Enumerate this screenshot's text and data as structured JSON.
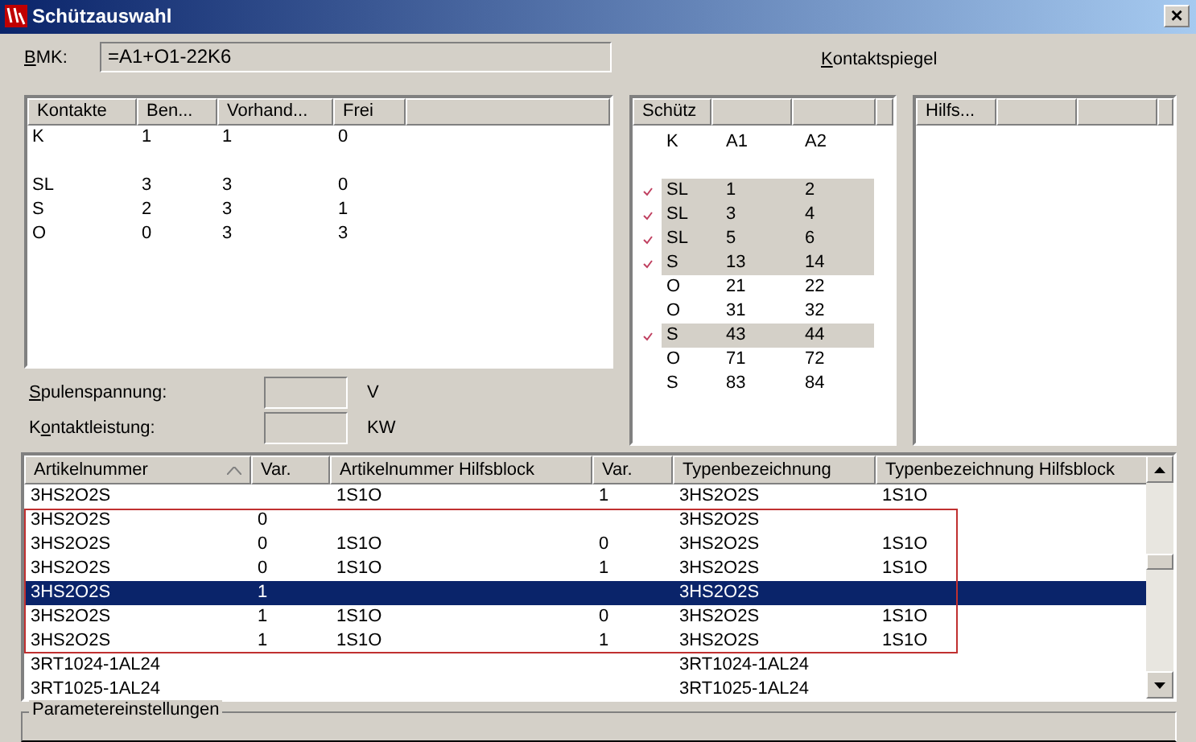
{
  "window": {
    "title": "Schützauswahl",
    "close": "×"
  },
  "bmk": {
    "label": "BMK:",
    "value": "=A1+O1-22K6"
  },
  "mirror_label": "Kontaktspiegel",
  "contacts": {
    "columns": [
      "Kontakte",
      "Ben...",
      "Vorhand...",
      "Frei"
    ],
    "rows": [
      {
        "kind": "row",
        "cells": [
          "K",
          "1",
          "1",
          "0"
        ]
      },
      {
        "kind": "gap"
      },
      {
        "kind": "row",
        "cells": [
          "SL",
          "3",
          "3",
          "0"
        ]
      },
      {
        "kind": "row",
        "cells": [
          "S",
          "2",
          "3",
          "1"
        ]
      },
      {
        "kind": "row",
        "cells": [
          "O",
          "0",
          "3",
          "3"
        ]
      }
    ]
  },
  "coil_voltage": {
    "label": "Spulenspannung:",
    "unit": "V"
  },
  "contact_power": {
    "label": "Kontaktleistung:",
    "unit": "KW"
  },
  "contactor": {
    "columns": [
      "Schütz"
    ],
    "rows": [
      {
        "kind": "row",
        "checked": false,
        "cells": [
          "K",
          "A1",
          "A2"
        ]
      },
      {
        "kind": "gap"
      },
      {
        "kind": "row",
        "checked": true,
        "cells": [
          "SL",
          "1",
          "2"
        ]
      },
      {
        "kind": "row",
        "checked": true,
        "cells": [
          "SL",
          "3",
          "4"
        ]
      },
      {
        "kind": "row",
        "checked": true,
        "cells": [
          "SL",
          "5",
          "6"
        ]
      },
      {
        "kind": "row",
        "checked": true,
        "cells": [
          "S",
          "13",
          "14"
        ]
      },
      {
        "kind": "row",
        "checked": false,
        "cells": [
          "O",
          "21",
          "22"
        ]
      },
      {
        "kind": "row",
        "checked": false,
        "cells": [
          "O",
          "31",
          "32"
        ]
      },
      {
        "kind": "row",
        "checked": true,
        "cells": [
          "S",
          "43",
          "44"
        ]
      },
      {
        "kind": "row",
        "checked": false,
        "cells": [
          "O",
          "71",
          "72"
        ]
      },
      {
        "kind": "row",
        "checked": false,
        "cells": [
          "S",
          "83",
          "84"
        ]
      }
    ]
  },
  "auxiliary": {
    "columns": [
      "Hilfs..."
    ]
  },
  "articles": {
    "columns": [
      {
        "label": "Artikelnummer",
        "sorted": true
      },
      {
        "label": "Var.",
        "sorted": false
      },
      {
        "label": "Artikelnummer Hilfsblock",
        "sorted": false
      },
      {
        "label": "Var.",
        "sorted": false
      },
      {
        "label": "Typenbezeichnung",
        "sorted": false
      },
      {
        "label": "Typenbezeichnung Hilfsblock",
        "sorted": false
      }
    ],
    "rows": [
      {
        "selected": false,
        "marked": false,
        "cells": [
          "3HS2O2S",
          "",
          "1S1O",
          "1",
          "3HS2O2S",
          "1S1O"
        ]
      },
      {
        "selected": false,
        "marked": true,
        "cells": [
          "3HS2O2S",
          "0",
          "",
          "",
          "3HS2O2S",
          ""
        ]
      },
      {
        "selected": false,
        "marked": true,
        "cells": [
          "3HS2O2S",
          "0",
          "1S1O",
          "0",
          "3HS2O2S",
          "1S1O"
        ]
      },
      {
        "selected": false,
        "marked": true,
        "cells": [
          "3HS2O2S",
          "0",
          "1S1O",
          "1",
          "3HS2O2S",
          "1S1O"
        ]
      },
      {
        "selected": true,
        "marked": true,
        "cells": [
          "3HS2O2S",
          "1",
          "",
          "",
          "3HS2O2S",
          ""
        ]
      },
      {
        "selected": false,
        "marked": true,
        "cells": [
          "3HS2O2S",
          "1",
          "1S1O",
          "0",
          "3HS2O2S",
          "1S1O"
        ]
      },
      {
        "selected": false,
        "marked": true,
        "cells": [
          "3HS2O2S",
          "1",
          "1S1O",
          "1",
          "3HS2O2S",
          "1S1O"
        ]
      },
      {
        "selected": false,
        "marked": false,
        "cells": [
          "3RT1024-1AL24",
          "",
          "",
          "",
          "3RT1024-1AL24",
          ""
        ]
      },
      {
        "selected": false,
        "marked": false,
        "cells": [
          "3RT1025-1AL24",
          "",
          "",
          "",
          "3RT1025-1AL24",
          ""
        ]
      }
    ]
  },
  "parameters": {
    "title": "Parametereinstellungen"
  }
}
